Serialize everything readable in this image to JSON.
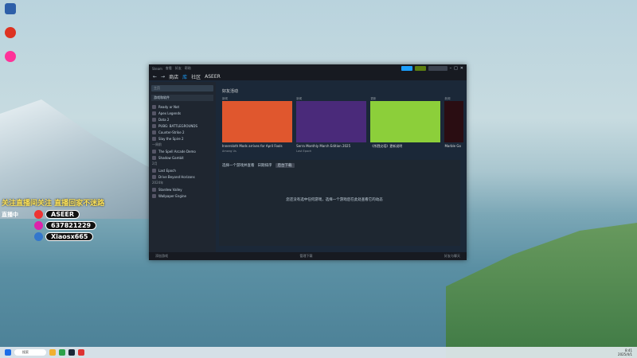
{
  "promo": {
    "headline": "关注直播间关注 直播回家不迷路",
    "rows": [
      {
        "label": "直播中",
        "handle": "ASEER",
        "color": "#e33"
      },
      {
        "label": "",
        "handle": "637821229",
        "color": "#d2a"
      },
      {
        "label": "",
        "handle": "Xiaosx665",
        "color": "#37c"
      }
    ]
  },
  "steam": {
    "menu": [
      "Steam",
      "查看",
      "好友",
      "帮助"
    ],
    "nav": [
      "商店",
      "库",
      "社区",
      "ASEER"
    ],
    "active_nav": 1,
    "sidebar": {
      "search_placeholder": "主页",
      "filter": "游戏和软件",
      "sections": [
        {
          "title": "",
          "items": [
            "Ready or Not",
            "Apex Legends",
            "Dota 2",
            "PUBG: BATTLEGROUNDS",
            "Counter-Strike 2",
            "Slay the Spire 2"
          ]
        },
        {
          "title": "一周前",
          "items": [
            "The Spell Arcade Demo",
            "Shadow Gambit"
          ]
        },
        {
          "title": "2月",
          "items": [
            "Last Epoch",
            "Drive Beyond Horizons"
          ]
        },
        {
          "title": "2024年",
          "items": [
            "Stardew Valley",
            "Wallpaper Engine"
          ]
        }
      ]
    },
    "featured": {
      "title": "好友活动",
      "cards": [
        {
          "tag": "新闻",
          "caption": "Innersloth Mods arrives for April Fools",
          "source": "Among Us",
          "color": "#e0572e"
        },
        {
          "tag": "新闻",
          "caption": "Serra Monthly March Edition 2025",
          "source": "Last Epoch",
          "color": "#4a2a7a"
        },
        {
          "tag": "更新",
          "caption": "《杀戮尖塔》更新说明",
          "source": "",
          "color": "#8ccf3a"
        },
        {
          "tag": "新闻",
          "caption": "Marble Go",
          "source": "",
          "color": "#2a0d12"
        }
      ]
    },
    "panel": {
      "header": "选择一个游戏并查看",
      "mode_label": "日期排序",
      "select_label": "后台下载",
      "message": "您还没有选中任何游戏，选择一个游戏后在此处查看它的动态"
    },
    "status": {
      "left": "添加游戏",
      "center": "管理下载",
      "right": "好友与聊天"
    }
  },
  "taskbar": {
    "search": "搜索",
    "time": "8:41",
    "date": "2025/4/1"
  }
}
